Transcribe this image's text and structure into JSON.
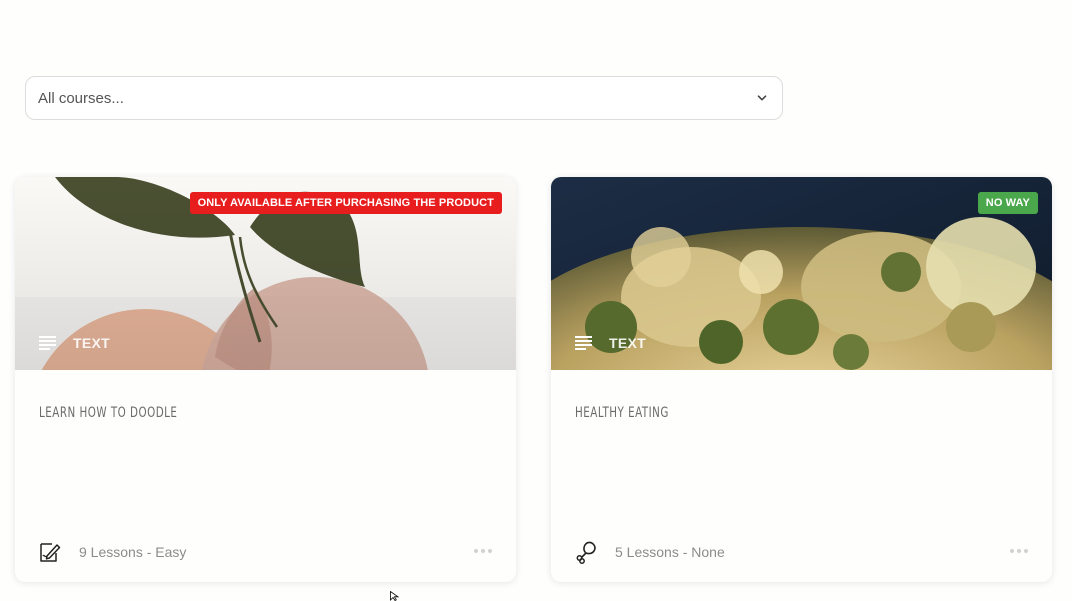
{
  "filter": {
    "selected": "All courses..."
  },
  "courses": [
    {
      "badge": "ONLY AVAILABLE AFTER PURCHASING THE PRODUCT",
      "badge_color": "#e81e1e",
      "type": "TEXT",
      "title": "LEARN HOW TO DOODLE",
      "meta": "9 Lessons - Easy",
      "icon": "pencil-document-icon"
    },
    {
      "badge": "NO WAY",
      "badge_color": "#4aa74c",
      "type": "TEXT",
      "title": "HEALTHY EATING",
      "meta": "5 Lessons - None",
      "icon": "drumstick-icon"
    }
  ]
}
